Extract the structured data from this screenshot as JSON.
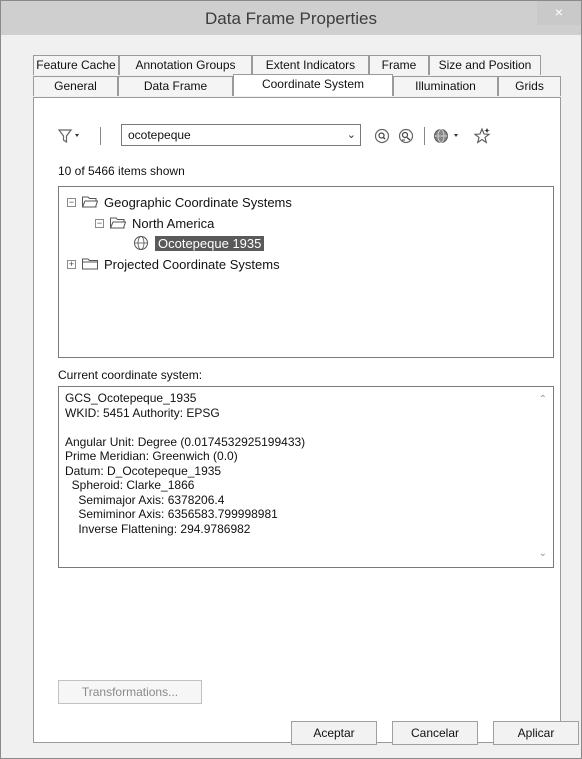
{
  "window": {
    "title": "Data Frame Properties",
    "close_glyph": "×"
  },
  "tabs_row1": [
    "Feature Cache",
    "Annotation Groups",
    "Extent Indicators",
    "Frame",
    "Size and Position"
  ],
  "tabs_row2": [
    "General",
    "Data Frame",
    "Coordinate System",
    "Illumination",
    "Grids"
  ],
  "active_tab": "Coordinate System",
  "toolbar": {
    "search_value": "ocotepeque",
    "dropdown_glyph": "⌄"
  },
  "items_count": "10 of 5466 items shown",
  "tree": {
    "n1": "Geographic Coordinate Systems",
    "n2": "North America",
    "n3": "Ocotepeque 1935",
    "n4": "Projected Coordinate Systems"
  },
  "current": {
    "label": "Current coordinate system:",
    "lines": [
      "GCS_Ocotepeque_1935",
      "WKID: 5451 Authority: EPSG",
      "",
      "Angular Unit: Degree (0.0174532925199433)",
      "Prime Meridian: Greenwich (0.0)",
      "Datum: D_Ocotepeque_1935",
      "  Spheroid: Clarke_1866",
      "    Semimajor Axis: 6378206.4",
      "    Semiminor Axis: 6356583.799998981",
      "    Inverse Flattening: 294.9786982"
    ]
  },
  "buttons": {
    "transformations": "Transformations...",
    "ok": "Aceptar",
    "cancel": "Cancelar",
    "apply": "Aplicar"
  }
}
